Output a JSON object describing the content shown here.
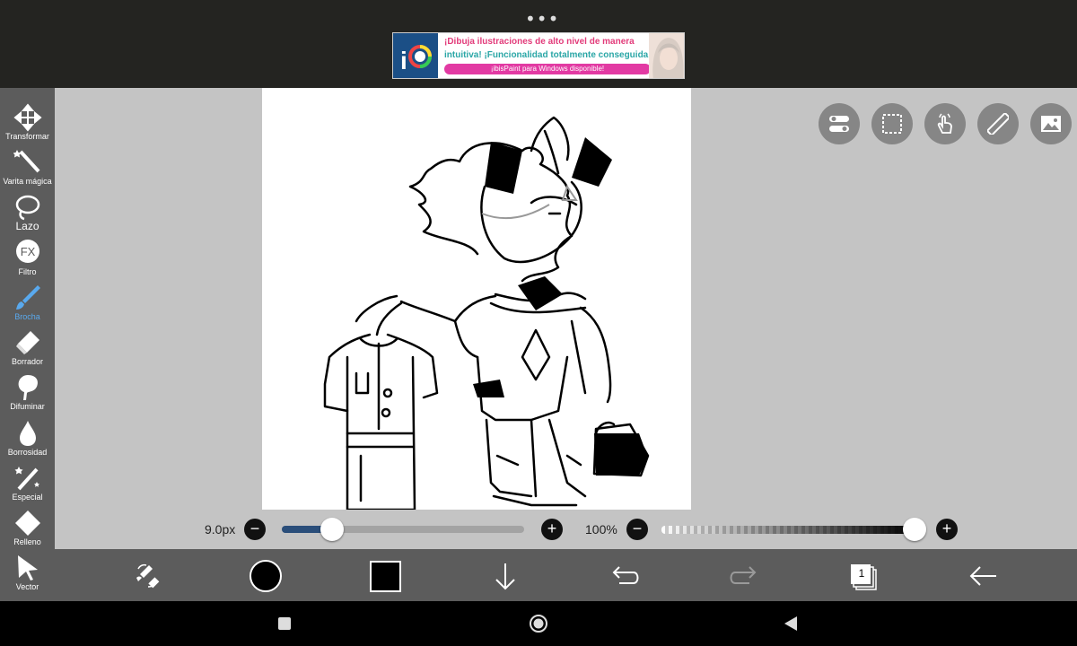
{
  "status": {
    "menu_dots": "•••"
  },
  "ad": {
    "line1": "¡Dibuja ilustraciones de alto nivel de manera",
    "line2": "intuitiva! ¡Funcionalidad totalmente conseguida!",
    "cta": "¡ibisPaint para Windows disponible!"
  },
  "tools": [
    {
      "label": "Transformar",
      "icon": "move-icon"
    },
    {
      "label": "Varita mágica",
      "icon": "magic-wand-icon"
    },
    {
      "label": "Lazo",
      "icon": "lasso-icon"
    },
    {
      "label": "Filtro",
      "icon": "fx-icon",
      "icon_text": "FX"
    },
    {
      "label": "Brocha",
      "icon": "brush-icon",
      "active": true
    },
    {
      "label": "Borrador",
      "icon": "eraser-icon"
    },
    {
      "label": "Difuminar",
      "icon": "blur-icon"
    },
    {
      "label": "Borrosidad",
      "icon": "drop-icon"
    },
    {
      "label": "Especial",
      "icon": "special-icon"
    },
    {
      "label": "Relleno",
      "icon": "fill-icon"
    },
    {
      "label": "Vector",
      "icon": "vector-icon"
    }
  ],
  "brush": {
    "size_label": "9.0px",
    "size_value": 0.2,
    "opacity_label": "100%",
    "opacity_value": 1.0
  },
  "layers": {
    "count": "1"
  },
  "colors": {
    "accent": "#59a9ee",
    "toolbar": "#5c5c5c",
    "workspace": "#c4c4c4",
    "current_color": "#000000"
  }
}
